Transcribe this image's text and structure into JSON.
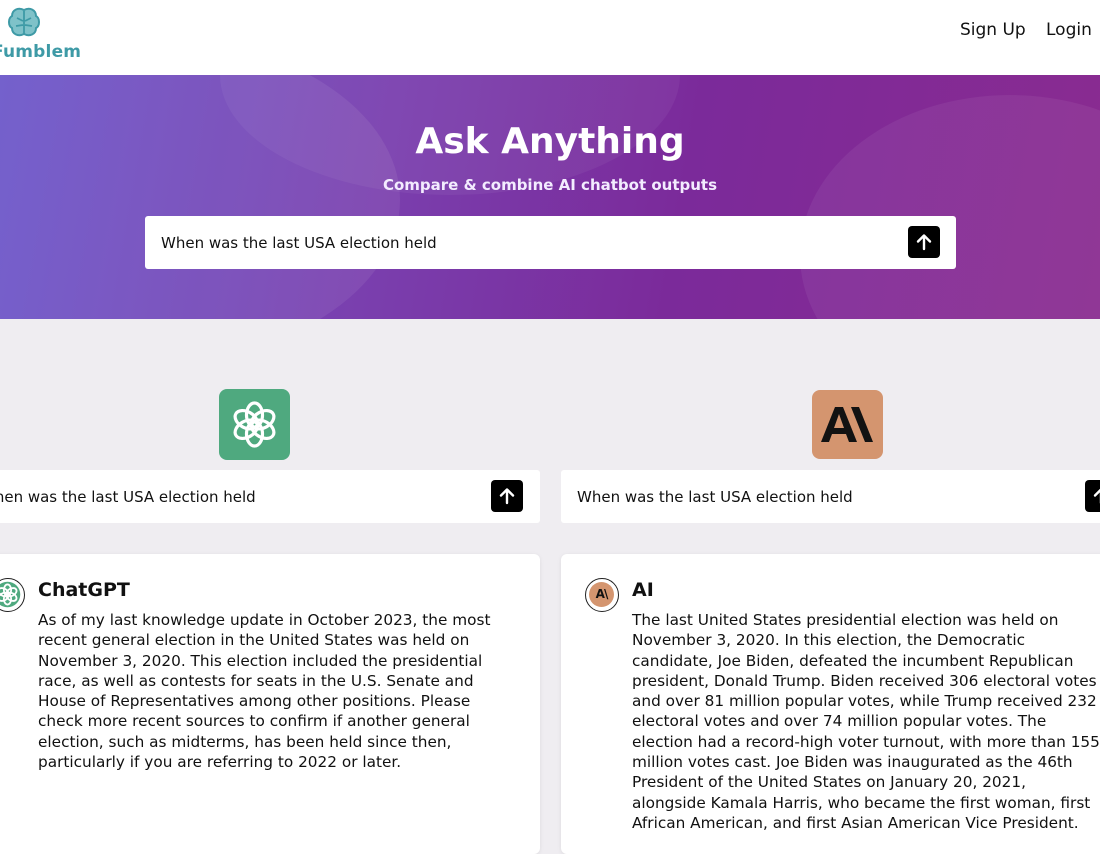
{
  "header": {
    "brand": "Fumblem",
    "nav": {
      "signup": "Sign Up",
      "login": "Login"
    }
  },
  "hero": {
    "title": "Ask Anything",
    "subtitle": "Compare & combine AI chatbot outputs",
    "search_value": "When was the last USA election held"
  },
  "panels": [
    {
      "model": "ChatGPT",
      "icon": "openai-logo-icon",
      "query": "When was the last USA election held",
      "response_lines": [
        "As of my last knowledge update in October 2023, the most",
        "recent general election in the United States was held on",
        "November 3, 2020. This election included the presidential",
        "race, as well as contests for seats in the U.S. Senate and",
        "House of Representatives among other positions. Please",
        "check more recent sources to confirm if another general",
        "election, such as midterms, has been held since then,",
        "particularly if you are referring to 2022 or later."
      ]
    },
    {
      "model": "AI",
      "icon": "anthropic-logo-icon",
      "query": "When was the last USA election held",
      "response_lines": [
        "The last United States presidential election was held on",
        "November 3, 2020. In this election, the Democratic",
        "candidate, Joe Biden, defeated the incumbent Republican",
        "president, Donald Trump. Biden received 306 electoral votes",
        "and over 81 million popular votes, while Trump received 232",
        "electoral votes and over 74 million popular votes. The",
        "election had a record-high voter turnout, with more than 155",
        "million votes cast. Joe Biden was inaugurated as the 46th",
        "President of the United States on January 20, 2021,",
        "alongside Kamala Harris, who became the first woman, first",
        "African American, and first Asian American Vice President."
      ]
    }
  ],
  "colors": {
    "hero_start": "#6a55c9",
    "hero_end": "#8a2b90",
    "chatgpt_green": "#4fa97f",
    "anthropic_tan": "#d4956f",
    "brand_teal": "#3e9aa6"
  }
}
